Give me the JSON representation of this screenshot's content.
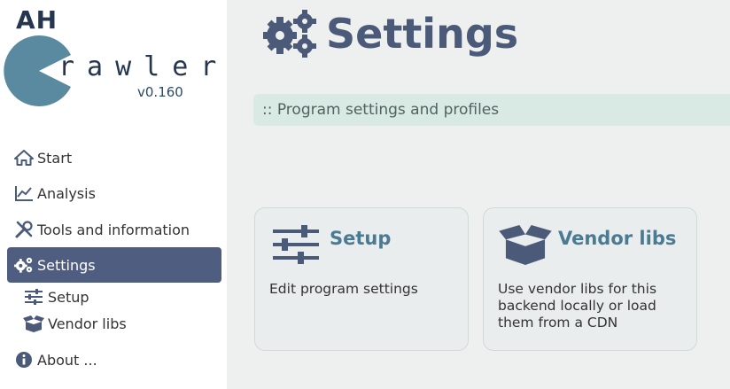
{
  "app": {
    "logo_ah": "AH",
    "logo_crawler": "rawler",
    "version": "v0.160"
  },
  "sidebar": {
    "items": [
      {
        "label": "Start",
        "icon": "home-icon"
      },
      {
        "label": "Analysis",
        "icon": "chart-line-icon"
      },
      {
        "label": "Tools and information",
        "icon": "tools-icon"
      },
      {
        "label": "Settings",
        "icon": "gears-icon",
        "active": true
      },
      {
        "label": "About ...",
        "icon": "info-icon"
      }
    ],
    "subitems": [
      {
        "label": "Setup",
        "icon": "sliders-icon"
      },
      {
        "label": "Vendor libs",
        "icon": "box-open-icon"
      }
    ]
  },
  "main": {
    "title": "Settings",
    "subtitle": ":: Program settings and profiles",
    "cards": [
      {
        "title": "Setup",
        "description": "Edit program settings",
        "icon": "sliders-icon"
      },
      {
        "title": "Vendor libs",
        "description": "Use vendor libs for this backend locally or load them from a CDN",
        "icon": "box-open-icon"
      }
    ]
  },
  "colors": {
    "sidebar_active_bg": "#4f5e80",
    "title_color": "#4a5a78",
    "card_title_color": "#4b7a93",
    "subtitle_bg": "#d9e9e3",
    "logo_circle": "#5a8aa0"
  }
}
